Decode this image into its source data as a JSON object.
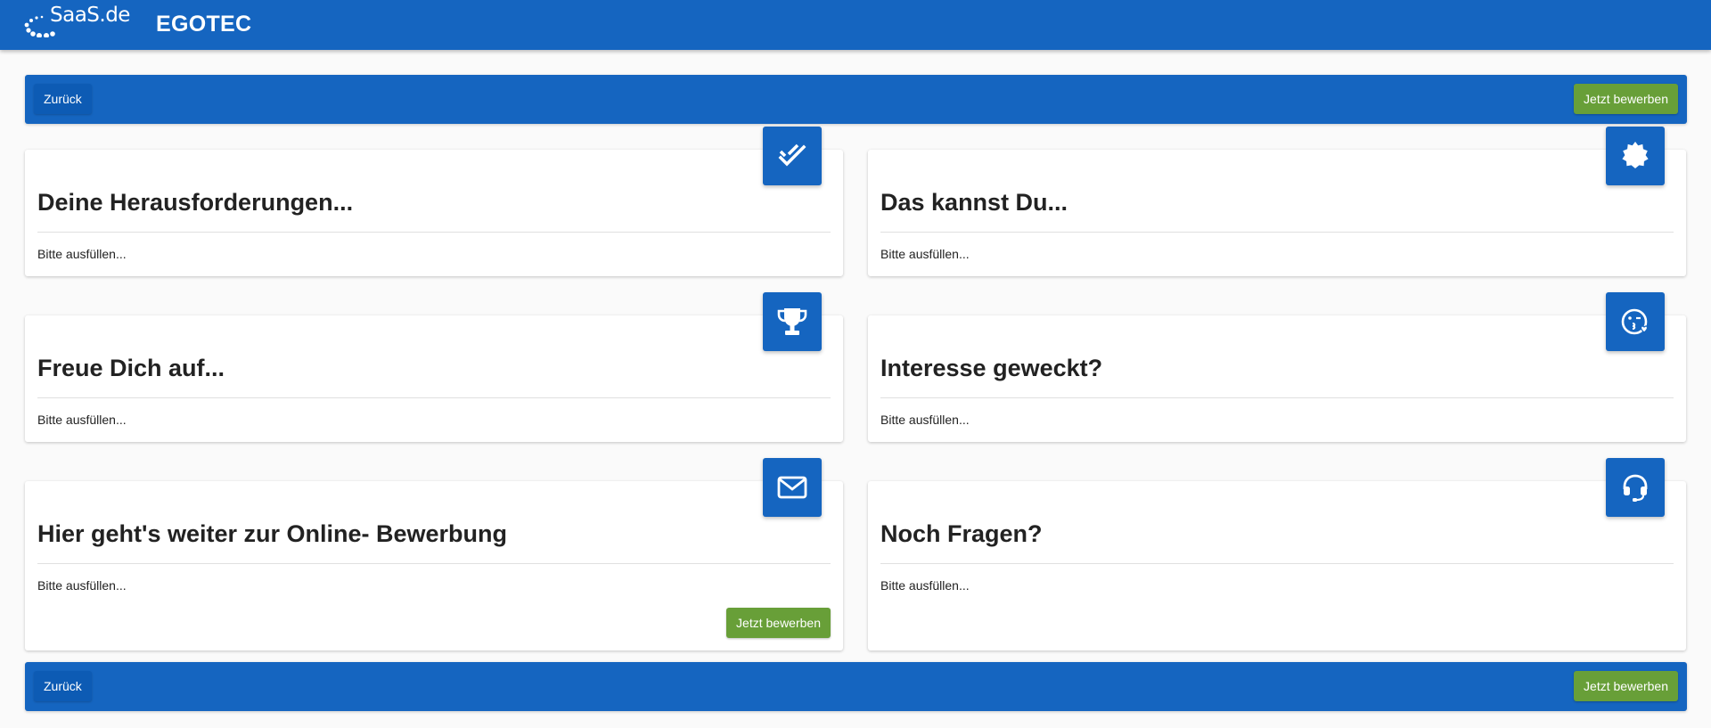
{
  "header": {
    "logo_text": "SaaS.de",
    "title": "EGOTEC"
  },
  "actionbar": {
    "back_label": "Zurück",
    "apply_label": "Jetzt bewerben"
  },
  "cards": [
    {
      "title": "Deine Herausforderungen...",
      "text": "Bitte ausfüllen...",
      "icon": "double-check-icon"
    },
    {
      "title": "Das kannst Du...",
      "text": "Bitte ausfüllen...",
      "icon": "badge-icon"
    },
    {
      "title": "Freue Dich auf...",
      "text": "Bitte ausfüllen...",
      "icon": "trophy-icon"
    },
    {
      "title": "Interesse geweckt?",
      "text": "Bitte ausfüllen...",
      "icon": "kiss-face-icon"
    },
    {
      "title": "Hier geht's weiter zur Online- Bewerbung",
      "text": "Bitte ausfüllen...",
      "icon": "envelope-icon",
      "button_label": "Jetzt bewerben"
    },
    {
      "title": "Noch Fragen?",
      "text": "Bitte ausfüllen...",
      "icon": "headset-icon"
    }
  ],
  "colors": {
    "primary": "#1565c0",
    "accent_green": "#689f38",
    "background": "#fafafa"
  }
}
